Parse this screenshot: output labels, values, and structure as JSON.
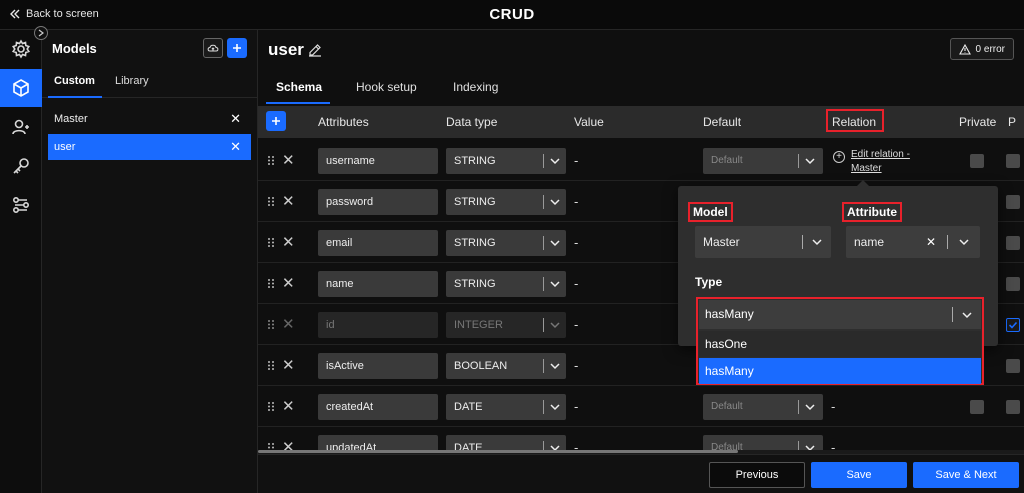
{
  "topbar": {
    "back_label": "Back to screen",
    "title": "CRUD"
  },
  "rail": {
    "items": [
      "settings-icon",
      "cube-icon",
      "user-icon",
      "key-icon",
      "flow-icon"
    ],
    "active": 1
  },
  "models": {
    "title": "Models",
    "tabs": [
      {
        "label": "Custom"
      },
      {
        "label": "Library"
      }
    ],
    "items": [
      {
        "name": "Master",
        "selected": false
      },
      {
        "name": "user",
        "selected": true
      }
    ]
  },
  "main": {
    "title": "user",
    "error_badge": "0 error",
    "tabs": [
      {
        "label": "Schema"
      },
      {
        "label": "Hook setup"
      },
      {
        "label": "Indexing"
      }
    ],
    "columns": {
      "attributes": "Attributes",
      "data_type": "Data type",
      "value": "Value",
      "default": "Default",
      "relation": "Relation",
      "private": "Private",
      "p": "P"
    },
    "rows": [
      {
        "name": "username",
        "type": "STRING",
        "value": "-",
        "default": "Default",
        "relation": "Edit relation - Master",
        "disabled": false
      },
      {
        "name": "password",
        "type": "STRING",
        "value": "-",
        "disabled": false
      },
      {
        "name": "email",
        "type": "STRING",
        "value": "-",
        "disabled": false
      },
      {
        "name": "name",
        "type": "STRING",
        "value": "-",
        "disabled": false
      },
      {
        "name": "id",
        "type": "INTEGER",
        "value": "-",
        "disabled": true
      },
      {
        "name": "isActive",
        "type": "BOOLEAN",
        "value": "-",
        "disabled": false
      },
      {
        "name": "createdAt",
        "type": "DATE",
        "value": "-",
        "default": "Default",
        "relation": "-",
        "disabled": false
      },
      {
        "name": "updatedAt",
        "type": "DATE",
        "value": "-",
        "default": "Default",
        "relation": "-",
        "disabled": false
      }
    ]
  },
  "relation_popup": {
    "model_label": "Model",
    "model_value": "Master",
    "attribute_label": "Attribute",
    "attribute_value": "name",
    "clear_glyph": "✕",
    "type_label": "Type",
    "type_value": "hasMany",
    "type_options": [
      "hasOne",
      "hasMany"
    ]
  },
  "footer": {
    "previous": "Previous",
    "save": "Save",
    "save_next": "Save & Next"
  },
  "colors": {
    "accent": "#1a6bff",
    "highlight": "#e8212b",
    "background": "#0f0f0f"
  }
}
